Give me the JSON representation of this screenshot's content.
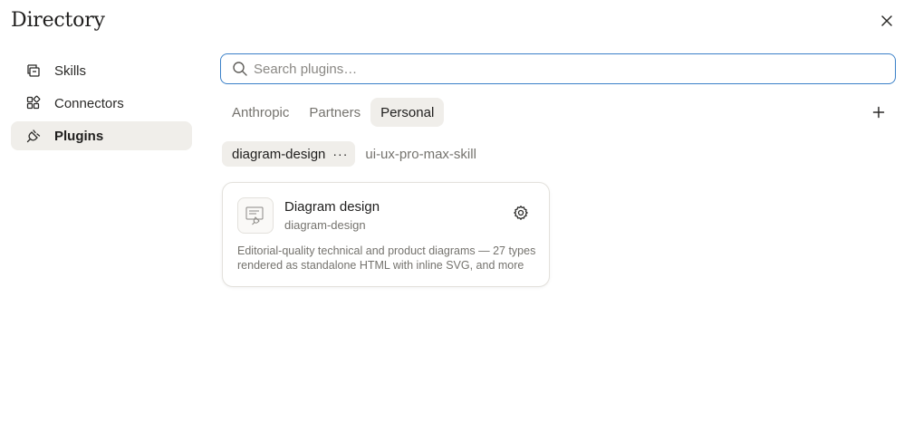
{
  "window": {
    "title": "Directory",
    "close_icon": "close-icon"
  },
  "sidebar": {
    "items": [
      {
        "label": "Skills",
        "icon": "skills-icon",
        "active": false
      },
      {
        "label": "Connectors",
        "icon": "connectors-icon",
        "active": false
      },
      {
        "label": "Plugins",
        "icon": "plug-icon",
        "active": true
      }
    ]
  },
  "search": {
    "placeholder": "Search plugins…",
    "value": ""
  },
  "tabs": [
    {
      "label": "Anthropic",
      "active": false
    },
    {
      "label": "Partners",
      "active": false
    },
    {
      "label": "Personal",
      "active": true
    }
  ],
  "add_icon": "plus-icon",
  "plugins": [
    {
      "label": "diagram-design",
      "active": true,
      "more": "···"
    },
    {
      "label": "ui-ux-pro-max-skill",
      "active": false
    }
  ],
  "card": {
    "title": "Diagram design",
    "subtitle": "diagram-design",
    "description": "Editorial-quality technical and product diagrams — 27 types rendered as standalone HTML with inline SVG, and more",
    "icon": "diagram-plugin-icon",
    "settings_icon": "gear-icon"
  },
  "colors": {
    "accent_border": "#3a80c8",
    "active_bg": "#f0eeea",
    "muted_text": "#75736e"
  }
}
